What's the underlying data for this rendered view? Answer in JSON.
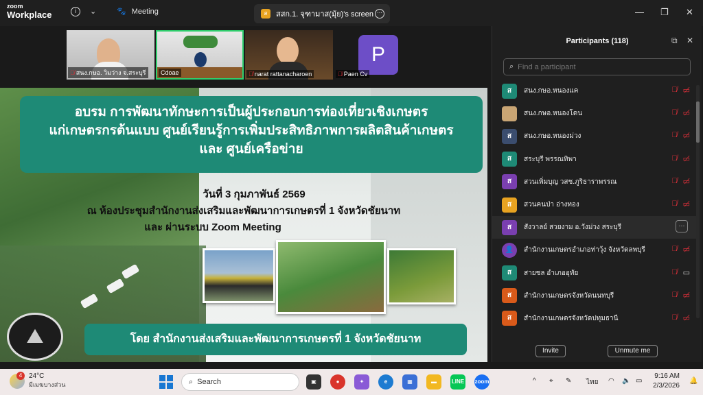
{
  "app": {
    "logo_top": "zoom",
    "logo_bottom": "Workplace",
    "meeting_label": "Meeting",
    "share_tab_icon": "ส",
    "share_tab_title": "สสก.1. จุฑามาส(มุ้ย)'s screen"
  },
  "thumbnails": [
    {
      "name": "สนง.กษอ. วิมว่าง จ.สระบุรี",
      "muted": true
    },
    {
      "name": "Cdoae",
      "muted": false,
      "active": true
    },
    {
      "name": "narat rattanacharoen",
      "muted": true
    },
    {
      "name": "Paen Cv",
      "muted": true,
      "initial": "P"
    }
  ],
  "slide": {
    "title_line1": "อบรม การพัฒนาทักษะการเป็นผู้ประกอบการท่องเที่ยวเชิงเกษตร",
    "title_line2": "แก่เกษตรกรต้นแบบ ศูนย์เรียนรู้การเพิ่มประสิทธิภาพการผลิตสินค้าเกษตร",
    "title_line3": "และ ศูนย์เครือข่าย",
    "date": "วันที่ 3 กุมภาพันธ์ 2569",
    "venue": "ณ ห้องประชุมสำนักงานส่งเสริมและพัฒนาการเกษตรที่ 1 จังหวัดชัยนาท",
    "online": "และ ผ่านระบบ Zoom Meeting",
    "organizer": "โดย สำนักงานส่งเสริมและพัฒนาการเกษตรที่ 1 จังหวัดชัยนาท"
  },
  "participants": {
    "title": "Participants (118)",
    "search_placeholder": "Find a participant",
    "list": [
      {
        "initial": "ส",
        "name": "สนง.กษอ.หนองแค",
        "color": "#1e8a76",
        "video": "off"
      },
      {
        "initial": "",
        "name": "สนง.กษอ.หนองโดน",
        "color": "#c9a574",
        "video": "off"
      },
      {
        "initial": "ส",
        "name": "สนง.กษอ.หนองม่วง",
        "color": "#3b4d6e",
        "video": "off"
      },
      {
        "initial": "ส",
        "name": "สระบุรี พรรณทิพา",
        "color": "#1e8a76",
        "video": "off"
      },
      {
        "initial": "ส",
        "name": "สวนเพิ่มบุญ วสช.ภูริธาราพรรณ",
        "color": "#7a3fb0",
        "video": "off"
      },
      {
        "initial": "ส",
        "name": "สวนคนป่า อ่างทอง",
        "color": "#e8a321",
        "video": "off"
      },
      {
        "initial": "ส",
        "name": "สังวาลย์ สวยงาม อ.วังม่วง สระบุรี",
        "color": "#7a3fb0",
        "video": "more",
        "highlight": true
      },
      {
        "initial": "",
        "name": "สำนักงานเกษตรอำเภอท่าวุ้ง จังหวัดลพบุรี",
        "color": "#7a3fb0",
        "video": "off"
      },
      {
        "initial": "ส",
        "name": "สายชล อำเภออุทัย",
        "color": "#1e8a76",
        "video": "on"
      },
      {
        "initial": "ส",
        "name": "สำนักงานเกษตรจังหวัดนนทบุรี",
        "color": "#d95a1a",
        "video": "off"
      },
      {
        "initial": "ส",
        "name": "สำนักงานเกษตรจังหวัดปทุมธานี",
        "color": "#d95a1a",
        "video": "off"
      }
    ],
    "invite_label": "Invite",
    "unmute_label": "Unmute me"
  },
  "taskbar": {
    "temp": "24°C",
    "weather_text": "มีเมฆบางส่วน",
    "weather_badge": "4",
    "search_label": "Search",
    "zoom_app": "zoom",
    "line_app": "LINE",
    "lang": "ไทย",
    "time": "9:16 AM",
    "date": "2/3/2026"
  }
}
